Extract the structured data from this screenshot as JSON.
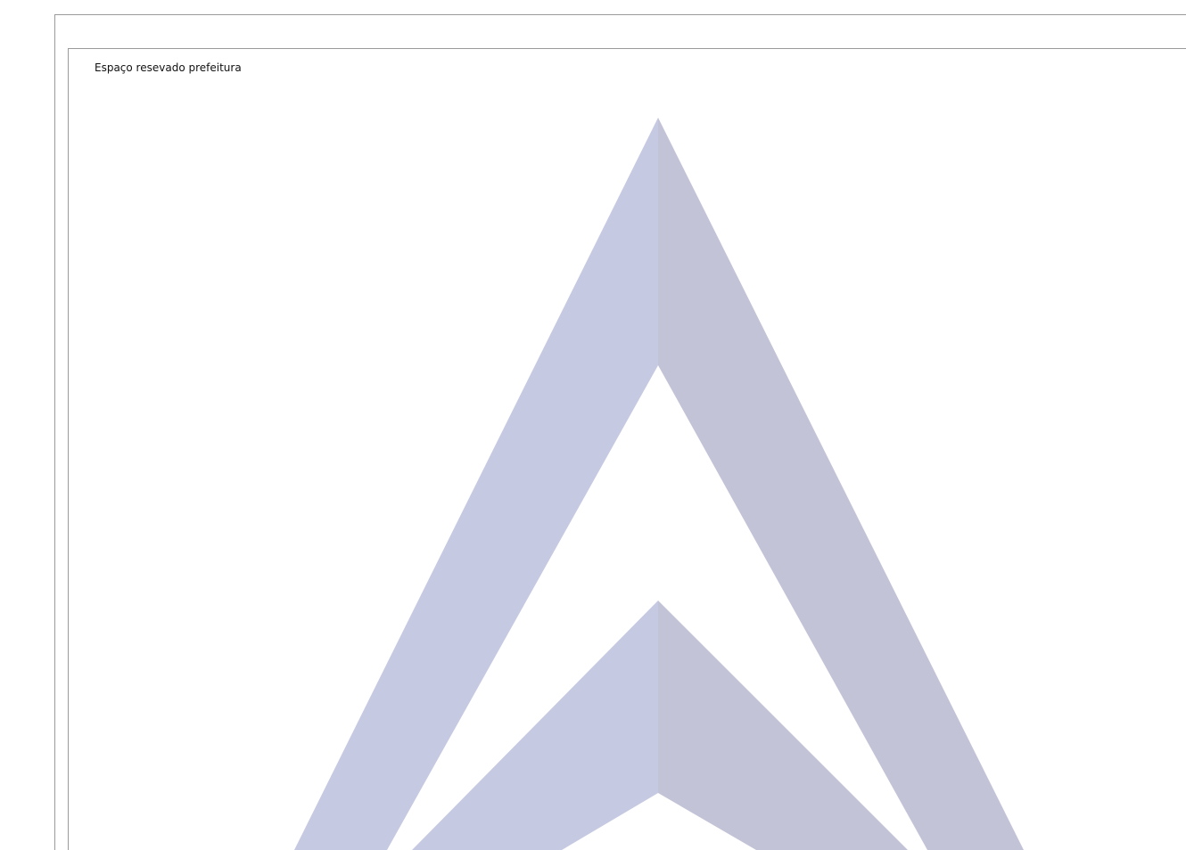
{
  "reserved_area": {
    "label": "Espaço resevado prefeitura"
  },
  "watermark": {
    "icon": "chevron-logo-watermark-icon",
    "color_left": "#c5c9e1",
    "color_right": "#c3c3d7"
  }
}
